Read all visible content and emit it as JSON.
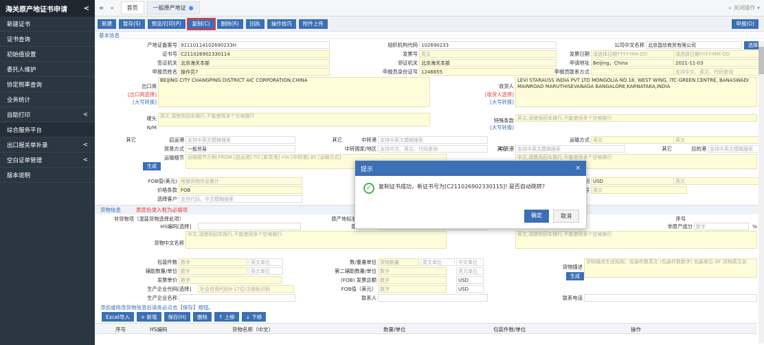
{
  "sidebar": {
    "title": "海关原产地证书申请",
    "collapse": "<",
    "items": [
      {
        "label": "新建证书",
        "arrow": ""
      },
      {
        "label": "证书查询",
        "arrow": ""
      },
      {
        "label": "初始值设置",
        "arrow": ""
      },
      {
        "label": "委托人维护",
        "arrow": ""
      },
      {
        "label": "协定税率查询",
        "arrow": ""
      },
      {
        "label": "业务统计",
        "arrow": ""
      },
      {
        "label": "自助打印",
        "arrow": "<"
      },
      {
        "label": "综合服务平台",
        "arrow": ""
      },
      {
        "label": "出口报关单补录",
        "arrow": "<"
      },
      {
        "label": "空白证单管理",
        "arrow": "<"
      },
      {
        "label": "版本说明",
        "arrow": ""
      }
    ]
  },
  "topbar": {
    "menu": "≡",
    "back": "«",
    "home": "首页",
    "tab": "一般原产地证",
    "tab_dot": "●",
    "right": "»  关闭操作 ▾"
  },
  "toolbar": {
    "buttons": [
      "新建",
      "暂存(S)",
      "预览/打印(P)",
      "复制(C)",
      "删除(R)",
      "回执",
      "操作技巧",
      "附件上传"
    ],
    "declare": "申报(O)"
  },
  "basic": {
    "title": "基本信息",
    "select_btn": "选择",
    "labels": {
      "org_code": "产地证备案号",
      "cert_no": "证书号",
      "visa": "签证机关",
      "app_name": "申报员姓名",
      "issuer": "出口商",
      "org_id": "组织机构代码",
      "inv_no": "发票号",
      "visa2": "领证机关",
      "app_id": "申报员身份证号",
      "co_cn": "公司中文名称",
      "inv_date": "发票日期",
      "app_addr": "申请地址",
      "app_tel": "申报员联系方式",
      "ship_date": "出证日期",
      "apply_date": "申请日期",
      "region": "进口国/地区",
      "consignee": "收货人",
      "mark": "唛头",
      "special": "特殊条款",
      "start": "启运港",
      "trans_port": "中转港",
      "dest": "目的港",
      "trade": "贸易方式",
      "trade_country": "中转国家/地区",
      "route": "运输细节",
      "transport": "运输方式",
      "vessel": "船名/航次",
      "fob": "FOB值(美元)",
      "total": "总金额",
      "price_cond": "价格条款",
      "contract": "合同号",
      "customer": "选择客户",
      "cust_name": "客户名称",
      "currency": "币制",
      "special2": "发票特殊条款"
    },
    "values": {
      "org_code": "91110114102690233H",
      "cert_no": "C211026902330114",
      "visa": "北京海关本部",
      "app_name": "操作员7",
      "issuer": "BEIJING CITY CHANGPING DISTRICT AIC CORPORATION,CHINA",
      "org_id": "102690233",
      "inv_no": "英文",
      "visa2": "北京海关本部",
      "app_id": "1246655",
      "co_cn": "北京昌欣商贸有限公司",
      "inv_date": "请选择日期YYYY-MM-DD",
      "app_addr": "Beijing，China",
      "app_tel": "",
      "ship_date": "请选择日期YYYY-MM-DD",
      "apply_date": "2021-11-03",
      "region": "支持中文、英文、代码查询",
      "consignee": "LEVI STARAUSS INDIA PVT LTD MONGOLIA NO.18, WEST WING, ITC-GREEN CENTRE, BANASWADI MAINROAD MARUTHISEVANAGA BANGALORE,KARNATAKA,INDIA",
      "mark": "英文,请使用回车换行,不能使用多个空格换行",
      "special": "英文,请使用回车换行,不能使用多个空格换行",
      "start": "支持中英文模糊搜索",
      "trans_port": "支持中英文模糊搜索",
      "dest": "支持中英文模糊搜索",
      "trade": "一般贸易",
      "trade_country": "支持中文、英文、代码查询",
      "route": "运输细节示例:FROM [启运港] TO [卸货港] VIA [中转港] BY [运输方式]",
      "route2": "中文,请使用回车换行,不能使用多个空格换行",
      "transport": "英文",
      "vessel": "英文",
      "fob": "根据货物信息累计",
      "total": "根据货物",
      "price_cond": "FOB",
      "contract": "英文",
      "customer": "支持代码、中文模糊搜索",
      "currency": "USD",
      "special2": "英文"
    },
    "flags": {
      "issuer_sel": "[出口商选择]",
      "upper": "[大写转换]",
      "nm": "N/M",
      "other": "其它",
      "consignee_sel": "[收货人选择]",
      "gen": "生成"
    }
  },
  "goods": {
    "title": "货物信息",
    "note": "黄底色录入框为必填项",
    "nav": "首条 上一条/下一条 末条",
    "labels": {
      "nogoods": "非货物项（混装货物选择此项）",
      "hs": "HS编码",
      "hs_sel": "[选择]",
      "origin_std": "原产地标准",
      "origin_desc": "原产地标准填写说明",
      "seq": "序号",
      "nonorig": "非原产成分",
      "pct": "%",
      "cn_name": "货物中文名称",
      "en_name": "货物英文名称",
      "pkg": "包装件数",
      "qty": "数/重量单位",
      "unit2": "辅助数量/单位",
      "qty2": "第二辅助数量/单位",
      "inv_val": "发票单价",
      "fob_inv": "(FOB) 发票总额",
      "prod_code": "生产企业代码",
      "prod_sel": "[选择]",
      "fob2": "FOB值（美元）",
      "prod_name": "生产企业名称",
      "contact": "联系人",
      "tel": "联系电话",
      "desc": "货物描述",
      "gen": "生成"
    },
    "values": {
      "cn_name": "中文,请使用回车换行,不能使用多个空格换行",
      "en_name": "英文,请使用回车换行,不能使用多个空格换行",
      "pkg": "数字",
      "pkg_u": "英文单位",
      "qty": "货物数量",
      "qty_u": "英文单位",
      "qty_cn": "中文单位",
      "unit2": "数字",
      "unit2_u": "英文单位",
      "qty2": "数字",
      "qty2_u": "英文单位",
      "inv_val": "数字",
      "fob_inv": "数字",
      "usd": "USD",
      "prod_code": "社会信用代码9-17位/注册标识码",
      "fob2": "数字",
      "nonorig": "数字",
      "desc": "货物描述生成规则：包装件数英文 (包装件数数字) 包装单位 OF 货物英文名"
    }
  },
  "list": {
    "hint": "添加或修改货物信息后请务必点击【保存】按钮。",
    "buttons": [
      "Excel导入",
      "+ 新增",
      "保存(H)",
      "删除",
      "↑ 上移",
      "↓ 下移"
    ],
    "columns": [
      "序号",
      "HS编码",
      "货物名称（中文）",
      "数量/单位",
      "包装件数/单位",
      "操作"
    ]
  },
  "dialog": {
    "title": "提示",
    "message": "复制证书成功，新证书号为[C211026902330115]! 是否自动跳转?",
    "ok": "确定",
    "cancel": "取消",
    "close": "×"
  }
}
